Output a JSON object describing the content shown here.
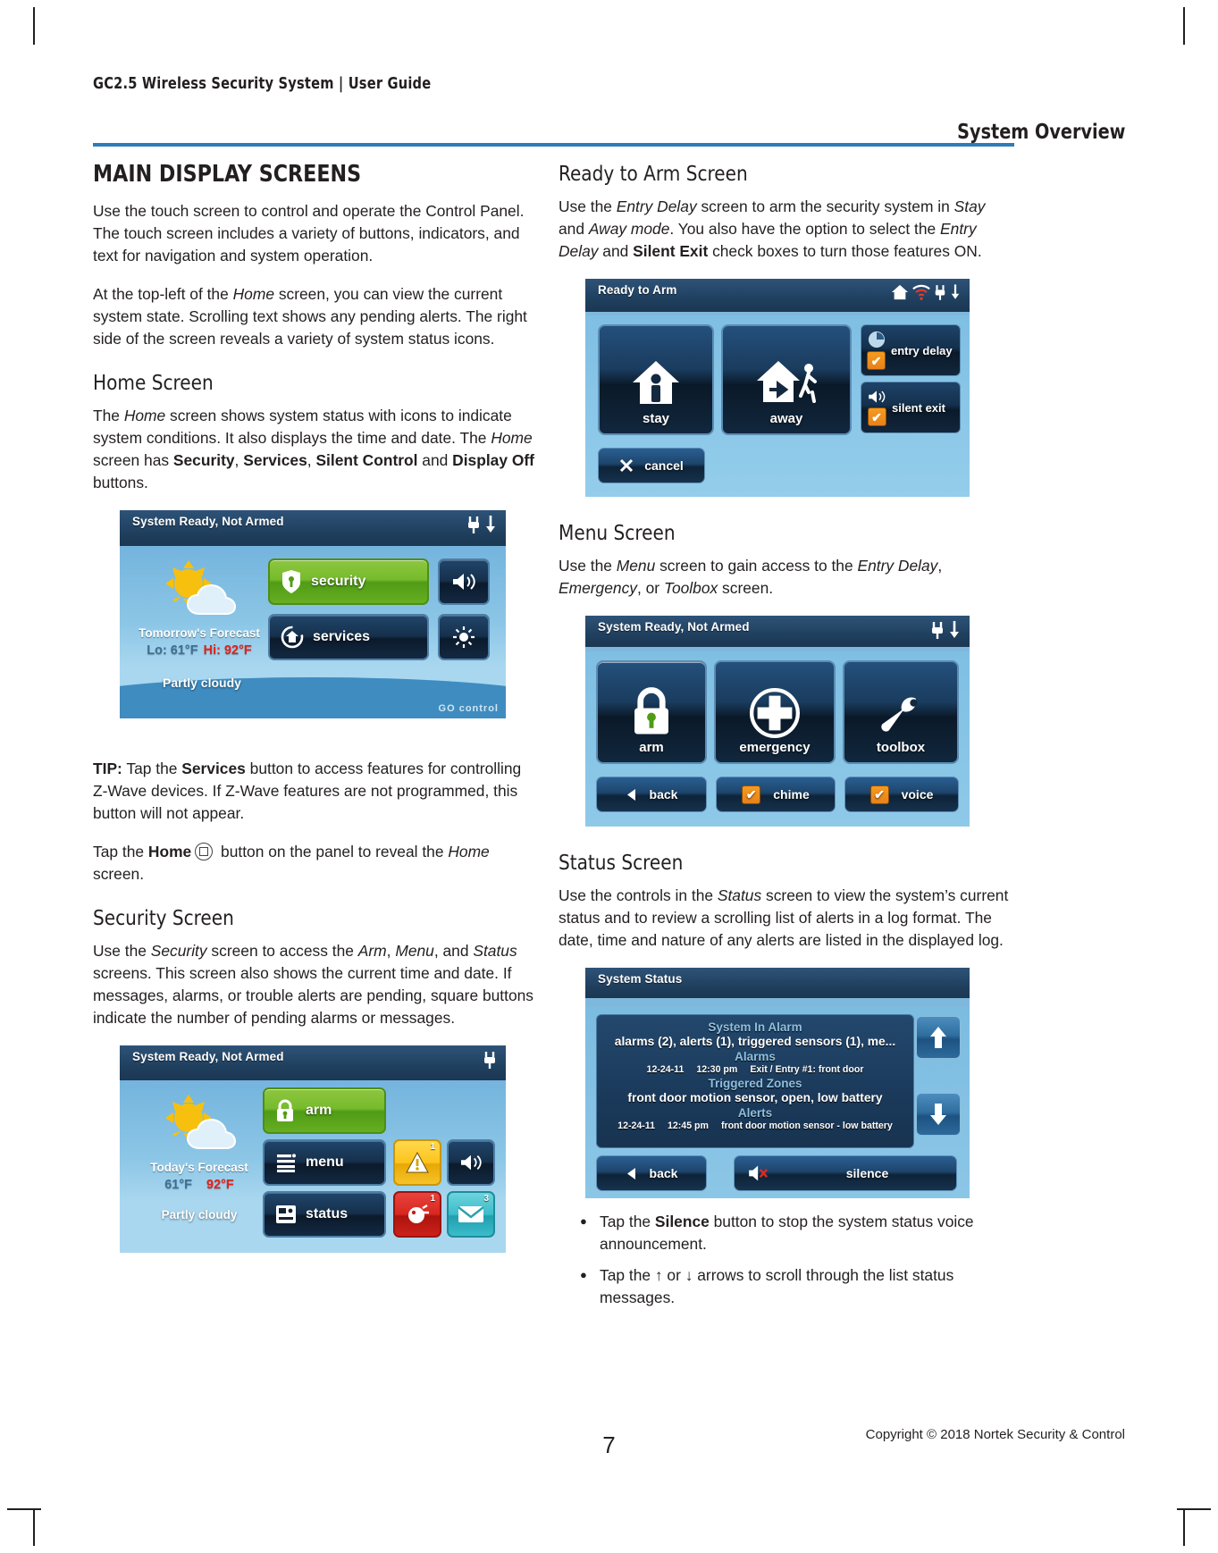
{
  "header": {
    "running_head": "GC2.5 Wireless Security System | User Guide",
    "section": "System Overview"
  },
  "footer": {
    "page_number": "7",
    "copyright": "Copyright ©  2018 Nortek Security & Control"
  },
  "left_column": {
    "title": "MAIN DISPLAY SCREENS",
    "para1": "Use the touch screen to control and operate the Control Panel. The touch screen includes a variety of buttons, indicators, and text for navigation and system operation.",
    "para2_a": "At the top-left of the ",
    "para2_i1": "Home",
    "para2_b": " screen, you can view the current system state. Scrolling text shows any pending alerts. The right side of the screen reveals a variety of system status icons.",
    "home_heading": "Home Screen",
    "home_para_a": "The ",
    "home_para_i1": "Home",
    "home_para_b": " screen shows system status with icons to indicate system conditions. It also displays the time and date. The ",
    "home_para_i2": "Home",
    "home_para_c": " screen has ",
    "home_para_bold1": "Security",
    "home_para_d": ", ",
    "home_para_bold2": "Services",
    "home_para_e": ", ",
    "home_para_bold3": "Silent Control",
    "home_para_f": " and ",
    "home_para_bold4": "Display Off",
    "home_para_g": " buttons.",
    "tip_label": "TIP:",
    "tip_a": " Tap the ",
    "tip_bold": "Services",
    "tip_b": " button to access features for controlling Z-Wave devices. If Z-Wave features are not programmed, this button will not appear.",
    "tap_a": "Tap the ",
    "tap_bold": "Home",
    "tap_b": " button on the panel to reveal the ",
    "tap_i": "Home",
    "tap_c": " screen.",
    "security_heading": "Security Screen",
    "security_para_a": "Use the ",
    "security_para_i1": "Security",
    "security_para_b": " screen to access the ",
    "security_para_i2": "Arm",
    "security_para_c": ", ",
    "security_para_i3": "Menu",
    "security_para_d": ", and ",
    "security_para_i4": "Status",
    "security_para_e": " screens. This screen also shows the current time and date. If messages, alarms, or trouble alerts are pending, square buttons indicate the number of pending alarms or messages."
  },
  "right_column": {
    "ready_heading": "Ready to Arm Screen",
    "ready_para_a": "Use the ",
    "ready_para_i1": "Entry Delay",
    "ready_para_b": " screen to arm the security system in ",
    "ready_para_i2": "Stay",
    "ready_para_c": " and ",
    "ready_para_i3": "Away mode",
    "ready_para_d": ". You also have the option to select the ",
    "ready_para_i4": "Entry Delay",
    "ready_para_e": " and ",
    "ready_para_bold": "Silent Exit",
    "ready_para_f": " check boxes to turn those features ON.",
    "menu_heading": "Menu Screen",
    "menu_para_a": "Use the ",
    "menu_para_i1": "Menu",
    "menu_para_b": " screen to gain access to the ",
    "menu_para_i2": "Entry Delay",
    "menu_para_c": ", ",
    "menu_para_i3": "Emergency",
    "menu_para_d": ", or ",
    "menu_para_i4": "Toolbox",
    "menu_para_e": " screen.",
    "status_heading": "Status Screen",
    "status_para_a": "Use the controls in the ",
    "status_para_i1": "Status",
    "status_para_b": " screen to view the system’s current status and to review a scrolling list of alerts in a log format. The date, time and nature of any alerts are listed in the displayed log.",
    "bullet1_a": "Tap the ",
    "bullet1_bold": "Silence",
    "bullet1_b": " button to stop the system status voice announcement.",
    "bullet2": "Tap the ↑ or ↓ arrows to scroll through the list status messages."
  },
  "panels": {
    "home": {
      "titlebar": "System Ready, Not Armed",
      "forecast_label": "Tomorrow's Forecast",
      "lo": "Lo: 61°F",
      "hi": "Hi: 92°F",
      "condition": "Partly cloudy",
      "btn_security": "security",
      "btn_services": "services",
      "logo": "GO control"
    },
    "security": {
      "titlebar": "System Ready, Not Armed",
      "forecast_label": "Today's Forecast",
      "lo": "61°F",
      "hi": "92°F",
      "condition": "Partly cloudy",
      "btn_arm": "arm",
      "btn_menu": "menu",
      "btn_status": "status",
      "badge_alert": "1",
      "badge_alarm": "1",
      "badge_message": "3"
    },
    "ready_to_arm": {
      "titlebar": "Ready to Arm",
      "btn_stay": "stay",
      "btn_away": "away",
      "chk_entry_delay": "entry delay",
      "chk_silent_exit": "silent exit",
      "btn_cancel": "cancel"
    },
    "menu": {
      "titlebar": "System Ready, Not Armed",
      "btn_arm": "arm",
      "btn_emergency": "emergency",
      "btn_toolbox": "toolbox",
      "btn_back": "back",
      "btn_chime": "chime",
      "btn_voice": "voice"
    },
    "status": {
      "titlebar": "System Status",
      "log_title": "System In Alarm",
      "log_summary": "alarms (2), alerts (1), triggered sensors (1), me...",
      "alarms_header": "Alarms",
      "alarm_date": "12-24-11",
      "alarm_time": "12:30 pm",
      "alarm_text": "Exit / Entry #1: front door",
      "zones_header": "Triggered Zones",
      "zones_text": "front door motion sensor, open, low battery",
      "alerts_header": "Alerts",
      "alert_date": "12-24-11",
      "alert_time": "12:45 pm",
      "alert_text": "front door motion sensor - low battery",
      "btn_back": "back",
      "btn_silence": "silence"
    }
  },
  "colors": {
    "rule": "#2b7cb9",
    "green": "#77bb2c",
    "dark_blue": "#1b3752",
    "hi_red": "#e32119",
    "lo_blue": "#3f6f94"
  }
}
